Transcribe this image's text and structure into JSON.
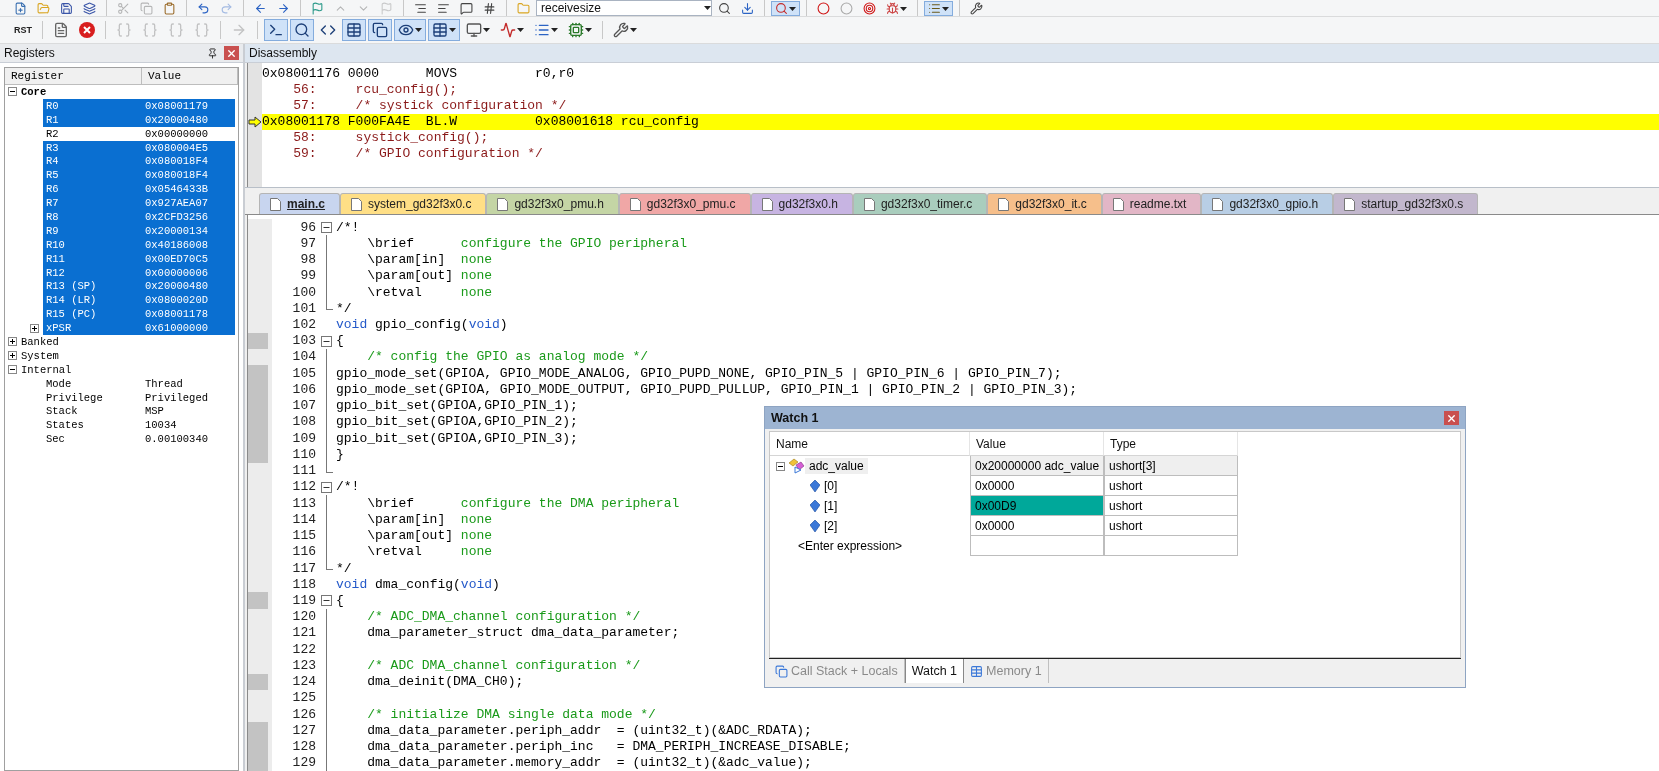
{
  "toolbar_1": {
    "items": [
      {
        "kind": "button",
        "pressed": false,
        "disabled": false,
        "dropdown": false
      },
      {
        "kind": "button",
        "pressed": false,
        "disabled": false,
        "dropdown": false
      },
      {
        "kind": "button",
        "pressed": false,
        "disabled": false,
        "dropdown": false
      },
      {
        "kind": "button",
        "pressed": false,
        "disabled": false,
        "dropdown": false
      },
      {
        "kind": "separator"
      },
      {
        "kind": "button",
        "pressed": false,
        "disabled": true,
        "dropdown": false
      },
      {
        "kind": "button",
        "pressed": false,
        "disabled": true,
        "dropdown": false
      },
      {
        "kind": "button",
        "pressed": false,
        "disabled": false,
        "dropdown": false
      },
      {
        "kind": "separator"
      },
      {
        "kind": "button",
        "pressed": false,
        "disabled": false,
        "dropdown": false
      },
      {
        "kind": "button",
        "pressed": false,
        "disabled": true,
        "dropdown": false
      },
      {
        "kind": "separator"
      },
      {
        "kind": "button",
        "pressed": false,
        "disabled": false,
        "dropdown": false
      },
      {
        "kind": "button",
        "pressed": false,
        "disabled": false,
        "dropdown": false
      },
      {
        "kind": "separator"
      },
      {
        "kind": "button",
        "pressed": false,
        "disabled": false,
        "dropdown": false
      },
      {
        "kind": "button",
        "pressed": false,
        "disabled": true,
        "dropdown": false
      },
      {
        "kind": "button",
        "pressed": false,
        "disabled": true,
        "dropdown": false
      },
      {
        "kind": "button",
        "pressed": false,
        "disabled": true,
        "dropdown": false
      },
      {
        "kind": "separator"
      },
      {
        "kind": "button",
        "pressed": false,
        "disabled": false,
        "dropdown": false
      },
      {
        "kind": "button",
        "pressed": false,
        "disabled": false,
        "dropdown": false
      },
      {
        "kind": "button",
        "pressed": false,
        "disabled": false,
        "dropdown": false
      },
      {
        "kind": "button",
        "pressed": false,
        "disabled": false,
        "dropdown": false
      },
      {
        "kind": "separator"
      },
      {
        "kind": "button",
        "pressed": false,
        "disabled": false,
        "dropdown": false
      },
      {
        "kind": "combo",
        "value": "receivesize"
      },
      {
        "kind": "button",
        "pressed": false,
        "disabled": false,
        "dropdown": false
      },
      {
        "kind": "button",
        "pressed": false,
        "disabled": false,
        "dropdown": false
      },
      {
        "kind": "separator"
      },
      {
        "kind": "button",
        "pressed": true,
        "disabled": false,
        "dropdown": true
      },
      {
        "kind": "separator"
      },
      {
        "kind": "button",
        "pressed": false,
        "disabled": false,
        "dropdown": false
      },
      {
        "kind": "button",
        "pressed": false,
        "disabled": false,
        "dropdown": false
      },
      {
        "kind": "button",
        "pressed": false,
        "disabled": false,
        "dropdown": false
      },
      {
        "kind": "button",
        "pressed": false,
        "disabled": false,
        "dropdown": true
      },
      {
        "kind": "separator"
      },
      {
        "kind": "button",
        "pressed": true,
        "disabled": false,
        "dropdown": true
      },
      {
        "kind": "separator"
      },
      {
        "kind": "button",
        "pressed": false,
        "disabled": false,
        "dropdown": false
      }
    ]
  },
  "toolbar_2": {
    "items": [
      {
        "kind": "button",
        "label": "RST",
        "pressed": false,
        "disabled": false,
        "dropdown": false
      },
      {
        "kind": "separator"
      },
      {
        "kind": "button",
        "pressed": false,
        "disabled": false,
        "dropdown": false
      },
      {
        "kind": "button",
        "pressed": false,
        "disabled": false,
        "dropdown": false
      },
      {
        "kind": "separator"
      },
      {
        "kind": "button",
        "pressed": false,
        "disabled": true,
        "dropdown": false
      },
      {
        "kind": "button",
        "pressed": false,
        "disabled": true,
        "dropdown": false
      },
      {
        "kind": "button",
        "pressed": false,
        "disabled": true,
        "dropdown": false
      },
      {
        "kind": "button",
        "pressed": false,
        "disabled": true,
        "dropdown": false
      },
      {
        "kind": "separator"
      },
      {
        "kind": "button",
        "pressed": false,
        "disabled": true,
        "dropdown": false
      },
      {
        "kind": "separator"
      },
      {
        "kind": "button",
        "pressed": true,
        "disabled": false,
        "dropdown": false
      },
      {
        "kind": "button",
        "pressed": true,
        "disabled": false,
        "dropdown": false
      },
      {
        "kind": "button",
        "pressed": false,
        "disabled": false,
        "dropdown": false
      },
      {
        "kind": "button",
        "pressed": true,
        "disabled": false,
        "dropdown": false
      },
      {
        "kind": "button",
        "pressed": true,
        "disabled": false,
        "dropdown": false
      },
      {
        "kind": "button",
        "pressed": true,
        "disabled": false,
        "dropdown": true
      },
      {
        "kind": "button",
        "pressed": true,
        "disabled": false,
        "dropdown": true
      },
      {
        "kind": "button",
        "pressed": false,
        "disabled": false,
        "dropdown": true
      },
      {
        "kind": "button",
        "pressed": false,
        "disabled": false,
        "dropdown": true
      },
      {
        "kind": "button",
        "pressed": false,
        "disabled": false,
        "dropdown": true
      },
      {
        "kind": "button",
        "pressed": false,
        "disabled": false,
        "dropdown": true
      },
      {
        "kind": "separator"
      },
      {
        "kind": "button",
        "pressed": false,
        "disabled": false,
        "dropdown": true
      }
    ]
  },
  "registers": {
    "title": "Registers",
    "columns": [
      "Register",
      "Value"
    ],
    "groups": [
      {
        "label": "Core",
        "expanded": true,
        "bold": true,
        "children": [
          {
            "name": "R0",
            "value": "0x08001179",
            "selected": true
          },
          {
            "name": "R1",
            "value": "0x20000480",
            "selected": true
          },
          {
            "name": "R2",
            "value": "0x00000000",
            "selected": false
          },
          {
            "name": "R3",
            "value": "0x080004E5",
            "selected": true
          },
          {
            "name": "R4",
            "value": "0x080018F4",
            "selected": true
          },
          {
            "name": "R5",
            "value": "0x080018F4",
            "selected": true
          },
          {
            "name": "R6",
            "value": "0x0546433B",
            "selected": true
          },
          {
            "name": "R7",
            "value": "0x927AEA07",
            "selected": true
          },
          {
            "name": "R8",
            "value": "0x2CFD3256",
            "selected": true
          },
          {
            "name": "R9",
            "value": "0x20000134",
            "selected": true
          },
          {
            "name": "R10",
            "value": "0x40186008",
            "selected": true
          },
          {
            "name": "R11",
            "value": "0x00ED70C5",
            "selected": true
          },
          {
            "name": "R12",
            "value": "0x00000006",
            "selected": true
          },
          {
            "name": "R13 (SP)",
            "value": "0x20000480",
            "selected": true
          },
          {
            "name": "R14 (LR)",
            "value": "0x0800020D",
            "selected": true
          },
          {
            "name": "R15 (PC)",
            "value": "0x08001178",
            "selected": true
          },
          {
            "name": "xPSR",
            "value": "0x61000000",
            "selected": true,
            "expandable": true
          }
        ]
      },
      {
        "label": "Banked",
        "expanded": false,
        "bold": false
      },
      {
        "label": "System",
        "expanded": false,
        "bold": false
      },
      {
        "label": "Internal",
        "expanded": true,
        "bold": false,
        "children": [
          {
            "name": "Mode",
            "value": "Thread",
            "selected": false
          },
          {
            "name": "Privilege",
            "value": "Privileged",
            "selected": false
          },
          {
            "name": "Stack",
            "value": "MSP",
            "selected": false
          },
          {
            "name": "States",
            "value": "10034",
            "selected": false
          },
          {
            "name": "Sec",
            "value": "0.00100340",
            "selected": false
          }
        ]
      }
    ]
  },
  "disassembly": {
    "title": "Disassembly",
    "lines": [
      {
        "kind": "asm",
        "text": "0x08001176 0000      MOVS          r0,r0",
        "current": false
      },
      {
        "kind": "src",
        "text": "    56:     rcu_config();",
        "current": false
      },
      {
        "kind": "src",
        "text": "    57:     /* systick configuration */",
        "current": false
      },
      {
        "kind": "asm",
        "text": "0x08001178 F000FA4E  BL.W          0x08001618 rcu_config",
        "current": true
      },
      {
        "kind": "src",
        "text": "    58:     systick_config();",
        "current": false
      },
      {
        "kind": "src",
        "text": "    59:     /* GPIO configuration */",
        "current": false
      }
    ]
  },
  "editor_tabs": [
    {
      "label": "main.c",
      "selected": true,
      "color": "#c8d5ef"
    },
    {
      "label": "system_gd32f3x0.c",
      "selected": false,
      "color": "#ffdf86"
    },
    {
      "label": "gd32f3x0_pmu.h",
      "selected": false,
      "color": "#c4d5a5"
    },
    {
      "label": "gd32f3x0_pmu.c",
      "selected": false,
      "color": "#f0a7a6"
    },
    {
      "label": "gd32f3x0.h",
      "selected": false,
      "color": "#c7b4e2"
    },
    {
      "label": "gd32f3x0_timer.c",
      "selected": false,
      "color": "#a9cdbd"
    },
    {
      "label": "gd32f3x0_it.c",
      "selected": false,
      "color": "#f6bf8b"
    },
    {
      "label": "readme.txt",
      "selected": false,
      "color": "#e2b6c6"
    },
    {
      "label": "gd32f3x0_gpio.h",
      "selected": false,
      "color": "#b8cee5"
    },
    {
      "label": "startup_gd32f3x0.s",
      "selected": false,
      "color": "#c2b7cd"
    }
  ],
  "code": [
    {
      "number": "96",
      "kind": "fold-start",
      "marker": false,
      "parts": [
        {
          "kind": "plain",
          "text": "/*!"
        }
      ]
    },
    {
      "number": "97",
      "kind": "fold-body",
      "marker": false,
      "parts": [
        {
          "kind": "plain",
          "text": "    \\brief      "
        },
        {
          "kind": "comment",
          "text": "configure the GPIO peripheral"
        }
      ]
    },
    {
      "number": "98",
      "kind": "fold-body",
      "marker": false,
      "parts": [
        {
          "kind": "plain",
          "text": "    \\param[in]  "
        },
        {
          "kind": "comment",
          "text": "none"
        }
      ]
    },
    {
      "number": "99",
      "kind": "fold-body",
      "marker": false,
      "parts": [
        {
          "kind": "plain",
          "text": "    \\param[out] "
        },
        {
          "kind": "comment",
          "text": "none"
        }
      ]
    },
    {
      "number": "100",
      "kind": "fold-body",
      "marker": false,
      "parts": [
        {
          "kind": "plain",
          "text": "    \\retval     "
        },
        {
          "kind": "comment",
          "text": "none"
        }
      ]
    },
    {
      "number": "101",
      "kind": "fold-end",
      "marker": false,
      "parts": [
        {
          "kind": "plain",
          "text": "*/"
        }
      ]
    },
    {
      "number": "102",
      "kind": "plain",
      "marker": false,
      "parts": [
        {
          "kind": "keyword",
          "text": "void"
        },
        {
          "kind": "plain",
          "text": " gpio_config("
        },
        {
          "kind": "keyword",
          "text": "void"
        },
        {
          "kind": "plain",
          "text": ")"
        }
      ]
    },
    {
      "number": "103",
      "kind": "fold-start",
      "marker": true,
      "parts": [
        {
          "kind": "plain",
          "text": "{"
        }
      ]
    },
    {
      "number": "104",
      "kind": "fold-body",
      "marker": false,
      "parts": [
        {
          "kind": "comment",
          "text": "    /* config the GPIO as analog mode */"
        }
      ]
    },
    {
      "number": "105",
      "kind": "fold-body",
      "marker": true,
      "parts": [
        {
          "kind": "plain",
          "text": "gpio_mode_set(GPIOA, GPIO_MODE_ANALOG, GPIO_PUPD_NONE, GPIO_PIN_5 | GPIO_PIN_6 | GPIO_PIN_7);"
        }
      ]
    },
    {
      "number": "106",
      "kind": "fold-body",
      "marker": true,
      "parts": [
        {
          "kind": "plain",
          "text": "gpio_mode_set(GPIOA, GPIO_MODE_OUTPUT, GPIO_PUPD_PULLUP, GPIO_PIN_1 | GPIO_PIN_2 | GPIO_PIN_3);"
        }
      ]
    },
    {
      "number": "107",
      "kind": "fold-body",
      "marker": true,
      "parts": [
        {
          "kind": "plain",
          "text": "gpio_bit_set(GPIOA,GPIO_PIN_1);"
        }
      ]
    },
    {
      "number": "108",
      "kind": "fold-body",
      "marker": true,
      "parts": [
        {
          "kind": "plain",
          "text": "gpio_bit_set(GPIOA,GPIO_PIN_2);"
        }
      ]
    },
    {
      "number": "109",
      "kind": "fold-body",
      "marker": true,
      "parts": [
        {
          "kind": "plain",
          "text": "gpio_bit_set(GPIOA,GPIO_PIN_3);"
        }
      ]
    },
    {
      "number": "110",
      "kind": "fold-body",
      "marker": true,
      "parts": [
        {
          "kind": "plain",
          "text": "}"
        }
      ]
    },
    {
      "number": "111",
      "kind": "fold-end",
      "marker": false
    },
    {
      "number": "112",
      "kind": "fold-start",
      "marker": false,
      "parts": [
        {
          "kind": "plain",
          "text": "/*!"
        }
      ]
    },
    {
      "number": "113",
      "kind": "fold-body",
      "marker": false,
      "parts": [
        {
          "kind": "plain",
          "text": "    \\brief      "
        },
        {
          "kind": "comment",
          "text": "configure the DMA peripheral"
        }
      ]
    },
    {
      "number": "114",
      "kind": "fold-body",
      "marker": false,
      "parts": [
        {
          "kind": "plain",
          "text": "    \\param[in]  "
        },
        {
          "kind": "comment",
          "text": "none"
        }
      ]
    },
    {
      "number": "115",
      "kind": "fold-body",
      "marker": false,
      "parts": [
        {
          "kind": "plain",
          "text": "    \\param[out] "
        },
        {
          "kind": "comment",
          "text": "none"
        }
      ]
    },
    {
      "number": "116",
      "kind": "fold-body",
      "marker": false,
      "parts": [
        {
          "kind": "plain",
          "text": "    \\retval     "
        },
        {
          "kind": "comment",
          "text": "none"
        }
      ]
    },
    {
      "number": "117",
      "kind": "fold-end",
      "marker": false,
      "parts": [
        {
          "kind": "plain",
          "text": "*/"
        }
      ]
    },
    {
      "number": "118",
      "kind": "plain",
      "marker": false,
      "parts": [
        {
          "kind": "keyword",
          "text": "void"
        },
        {
          "kind": "plain",
          "text": " dma_config("
        },
        {
          "kind": "keyword",
          "text": "void"
        },
        {
          "kind": "plain",
          "text": ")"
        }
      ]
    },
    {
      "number": "119",
      "kind": "fold-start",
      "marker": true,
      "parts": [
        {
          "kind": "plain",
          "text": "{"
        }
      ]
    },
    {
      "number": "120",
      "kind": "fold-body",
      "marker": false,
      "parts": [
        {
          "kind": "comment",
          "text": "    /* ADC_DMA_channel configuration */"
        }
      ]
    },
    {
      "number": "121",
      "kind": "fold-body",
      "marker": false,
      "parts": [
        {
          "kind": "plain",
          "text": "    dma_parameter_struct dma_data_parameter;"
        }
      ]
    },
    {
      "number": "122",
      "kind": "fold-body",
      "marker": false
    },
    {
      "number": "123",
      "kind": "fold-body",
      "marker": false,
      "parts": [
        {
          "kind": "comment",
          "text": "    /* ADC DMA_channel configuration */"
        }
      ]
    },
    {
      "number": "124",
      "kind": "fold-body",
      "marker": true,
      "parts": [
        {
          "kind": "plain",
          "text": "    dma_deinit(DMA_CH0);"
        }
      ]
    },
    {
      "number": "125",
      "kind": "fold-body",
      "marker": false
    },
    {
      "number": "126",
      "kind": "fold-body",
      "marker": false,
      "parts": [
        {
          "kind": "comment",
          "text": "    /* initialize DMA single data mode */"
        }
      ]
    },
    {
      "number": "127",
      "kind": "fold-body",
      "marker": true,
      "parts": [
        {
          "kind": "plain",
          "text": "    dma_data_parameter.periph_addr  = (uint32_t)(&ADC_RDATA);"
        }
      ]
    },
    {
      "number": "128",
      "kind": "fold-body",
      "marker": true,
      "parts": [
        {
          "kind": "plain",
          "text": "    dma_data_parameter.periph_inc   = DMA_PERIPH_INCREASE_DISABLE;"
        }
      ]
    },
    {
      "number": "129",
      "kind": "fold-body",
      "marker": true,
      "parts": [
        {
          "kind": "plain",
          "text": "    dma_data_parameter.memory_addr  = (uint32_t)(&adc_value);"
        }
      ]
    }
  ],
  "watch": {
    "title": "Watch 1",
    "columns": [
      "Name",
      "Value",
      "Type"
    ],
    "rows": [
      {
        "name": "adc_value",
        "value": "0x20000000 adc_value",
        "type": "ushort[3]",
        "selected": true,
        "expanded": true,
        "children": [
          {
            "name": "[0]",
            "value": "0x0000",
            "type": "ushort",
            "selected": false,
            "changed": false
          },
          {
            "name": "[1]",
            "value": "0x00D9",
            "type": "ushort",
            "selected": false,
            "changed": true
          },
          {
            "name": "[2]",
            "value": "0x0000",
            "type": "ushort",
            "selected": false,
            "changed": false
          }
        ]
      }
    ],
    "new_row_label": "<Enter expression>",
    "tabs": [
      {
        "label": "Call Stack + Locals",
        "selected": false
      },
      {
        "label": "Watch 1",
        "selected": true
      },
      {
        "label": "Memory 1",
        "selected": false
      }
    ]
  }
}
